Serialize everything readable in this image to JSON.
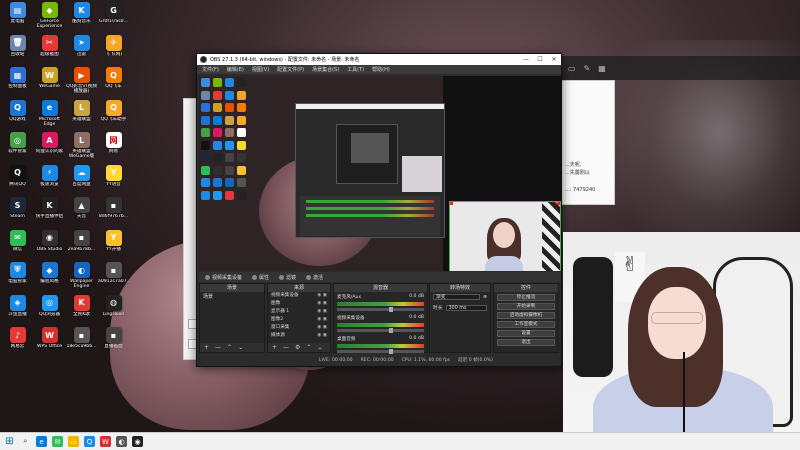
{
  "desktop": {
    "icons": [
      {
        "label": "此电脑",
        "color": "#3d8be0",
        "glyph": "▤"
      },
      {
        "label": "GeForce Experience",
        "color": "#76b900",
        "glyph": "◆"
      },
      {
        "label": "酷狗音乐",
        "color": "#1e88e5",
        "glyph": "K"
      },
      {
        "label": "Gr0f1\\rSs0...",
        "color": "#222222",
        "glyph": "G"
      },
      {
        "label": "回收站",
        "color": "#6b86a6",
        "glyph": "🗑"
      },
      {
        "label": "超级截图",
        "color": "#e53935",
        "glyph": "✂"
      },
      {
        "label": "迅雷",
        "color": "#1e88e5",
        "glyph": "➤"
      },
      {
        "label": "飞飞(网)",
        "color": "#f5a623",
        "glyph": "✈"
      },
      {
        "label": "控制面板",
        "color": "#2e6fd2",
        "glyph": "▦"
      },
      {
        "label": "WeGame",
        "color": "#c9a227",
        "glyph": "W"
      },
      {
        "label": "QQ影音\\r(视频播放器)",
        "color": "#e65100",
        "glyph": "▶"
      },
      {
        "label": "QQ飞车",
        "color": "#f57c00",
        "glyph": "Q"
      },
      {
        "label": "QQ游戏",
        "color": "#1976d2",
        "glyph": "Q"
      },
      {
        "label": "Microsoft Edge",
        "color": "#0a7cd8",
        "glyph": "e"
      },
      {
        "label": "英雄联盟",
        "color": "#caa441",
        "glyph": "L"
      },
      {
        "label": "QQ飞车助手",
        "color": "#f9a825",
        "glyph": "Q"
      },
      {
        "label": "软件管家",
        "color": "#43a047",
        "glyph": "◎"
      },
      {
        "label": "阿狸认识的家",
        "color": "#d81b60",
        "glyph": "A"
      },
      {
        "label": "英雄联盟 WeGame版",
        "color": "#8d6e63",
        "glyph": "L"
      },
      {
        "label": "网易",
        "color": "#ffffff",
        "glyph": "网"
      },
      {
        "label": "腾讯QQ",
        "color": "#111111",
        "glyph": "Q"
      },
      {
        "label": "极速浏览",
        "color": "#1e88e5",
        "glyph": "⚡"
      },
      {
        "label": "百度网盘",
        "color": "#2196f3",
        "glyph": "☁"
      },
      {
        "label": "YY语音",
        "color": "#fdd835",
        "glyph": "Y"
      },
      {
        "label": "Steam",
        "color": "#1b2838",
        "glyph": "S"
      },
      {
        "label": "快手直播伴侣",
        "color": "#222222",
        "glyph": "K"
      },
      {
        "label": "天音",
        "color": "#444444",
        "glyph": "▲"
      },
      {
        "label": "8d6f9767b...",
        "color": "#333333",
        "glyph": "▪"
      },
      {
        "label": "微信",
        "color": "#2ebd59",
        "glyph": "✉"
      },
      {
        "label": "OBS Studio",
        "color": "#302e31",
        "glyph": "◉"
      },
      {
        "label": "2ea9b78b...",
        "color": "#444444",
        "glyph": "▪"
      },
      {
        "label": "YY开播",
        "color": "#fbc02d",
        "glyph": "Y"
      },
      {
        "label": "电脑管家",
        "color": "#1e88e5",
        "glyph": "⛨"
      },
      {
        "label": "编程风格",
        "color": "#1976d2",
        "glyph": "◆"
      },
      {
        "label": "Wallpaper Engine",
        "color": "#1565c0",
        "glyph": "◐"
      },
      {
        "label": "a0912c7a07...",
        "color": "#555555",
        "glyph": "▪"
      },
      {
        "label": "斗鱼直播",
        "color": "#1e88e5",
        "glyph": "◈"
      },
      {
        "label": "QQ浏览器",
        "color": "#2196f3",
        "glyph": "◎"
      },
      {
        "label": "全民K歌",
        "color": "#e53935",
        "glyph": "K"
      },
      {
        "label": "LingHoon",
        "color": "#222222",
        "glyph": "◍"
      },
      {
        "label": "网易云",
        "color": "#e53935",
        "glyph": "♪"
      },
      {
        "label": "WPS Office",
        "color": "#d32f2f",
        "glyph": "W"
      },
      {
        "label": "18e5ca9bb...",
        "color": "#555555",
        "glyph": "▪"
      },
      {
        "label": "直播画面",
        "color": "#444444",
        "glyph": "▪"
      }
    ]
  },
  "background_window": {
    "chat_lines": [
      "...天呢,",
      "...先露刚以",
      "...: 7479240"
    ]
  },
  "obs": {
    "title": "OBS 27.1.3 (64-bit, windows) - 配置文件: 未命名 - 场景: 未命名",
    "window_buttons": [
      "—",
      "☐",
      "✕"
    ],
    "menu": [
      "文件(F)",
      "编辑(E)",
      "视图(V)",
      "配置文件(P)",
      "场景集合(S)",
      "工具(T)",
      "帮助(H)"
    ],
    "source_toolbar": {
      "source_name": "视频采集设备",
      "properties": "属性",
      "filters": "滤镜",
      "device": "激活"
    },
    "docks": {
      "scenes": {
        "title": "场景",
        "items": [
          "场景"
        ]
      },
      "sources": {
        "title": "来源",
        "items": [
          "视频采集设备",
          "图像",
          "显示器 1",
          "图像2",
          "窗口采集",
          "媒体源"
        ]
      },
      "mixer": {
        "title": "混音器",
        "channels": [
          {
            "name": "麦克风/Aux",
            "db": "0.0 dB"
          },
          {
            "name": "视频采集设备",
            "db": "0.0 dB"
          },
          {
            "name": "桌面音频",
            "db": "0.0 dB"
          }
        ]
      },
      "transitions": {
        "title": "转场特效",
        "type": "渐变",
        "duration_label": "时长",
        "duration": "300 ms"
      },
      "controls": {
        "title": "控件",
        "buttons": [
          "停止推流",
          "开始录制",
          "启动虚拟摄像机",
          "工作室模式",
          "设置",
          "退出"
        ]
      }
    },
    "footer_buttons": [
      "+",
      "—",
      "⌃",
      "⌄"
    ],
    "status": {
      "live": "LIVE: 00:00:00",
      "rec": "REC: 00:00:00",
      "cpu": "CPU: 1.1%, 60.00 fps",
      "extra": "延迟 0 帧(0.0%)"
    }
  },
  "taskbar": {
    "start": "⊞",
    "search": "⌕",
    "apps": [
      {
        "name": "edge",
        "color": "#0a7cd8",
        "glyph": "e"
      },
      {
        "name": "wechat",
        "color": "#2ebd59",
        "glyph": "✉"
      },
      {
        "name": "explorer",
        "color": "#f2b400",
        "glyph": "▭"
      },
      {
        "name": "qq",
        "color": "#1e88e5",
        "glyph": "Q"
      },
      {
        "name": "wps",
        "color": "#d32f2f",
        "glyph": "W"
      },
      {
        "name": "app6",
        "color": "#555555",
        "glyph": "◐"
      },
      {
        "name": "obs",
        "color": "#222222",
        "glyph": "◉"
      }
    ]
  },
  "colors": {
    "accent": "#0067c0",
    "obs_bg": "#2b2b2b",
    "live_green": "#4caf50"
  }
}
